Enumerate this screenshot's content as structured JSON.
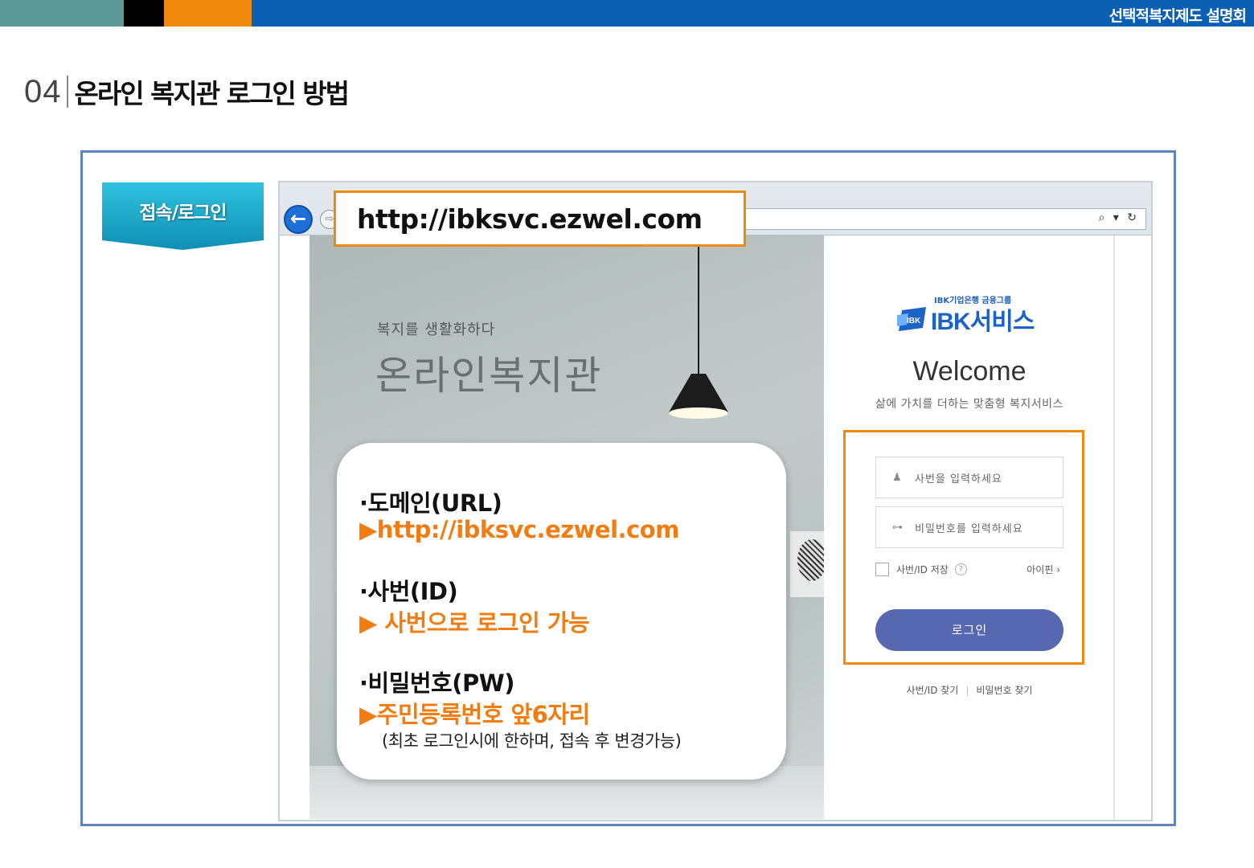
{
  "header": {
    "title": "선택적복지제도 설명회",
    "section_number": "04",
    "section_title": "온라인 복지관 로그인 방법"
  },
  "ribbon": {
    "label": "접속/로그인"
  },
  "url_callout": {
    "text": "http://ibksvc.ezwel.com"
  },
  "hero": {
    "subtitle": "복지를 생활화하다",
    "title": "온라인복지관"
  },
  "login": {
    "brand_group": "IBK기업은행 금융그룹",
    "brand_name": "IBK서비스",
    "welcome": "Welcome",
    "welcome_sub": "삶에 가치를 더하는 맞춤형 복지서비스",
    "id_placeholder": "사번을 입력하세요",
    "pw_placeholder": "비밀번호를 입력하세요",
    "save_id_label": "사번/ID 저장",
    "help_mark": "?",
    "ipin_label": "아이핀 ›",
    "login_button": "로그인",
    "find_id": "사번/ID 찾기",
    "find_pw": "비밀번호 찾기"
  },
  "info": {
    "domain_label": "·도메인(URL)",
    "domain_value": "▶http://ibksvc.ezwel.com",
    "id_label": "·사번(ID)",
    "id_value": "▶ 사번으로 로그인 가능",
    "pw_label": "·비밀번호(PW)",
    "pw_value": "▶주민등록번호 앞6자리",
    "pw_note": "(최초 로그인시에 한하며, 접속 후 변경가능)"
  },
  "colors": {
    "accent_orange": "#f08a0c",
    "header_blue": "#0b5fb3",
    "frame_blue": "#5f82c0",
    "ribbon_teal": "#1aaed0",
    "login_button": "#5668b0",
    "highlight_text": "#f07c12"
  }
}
